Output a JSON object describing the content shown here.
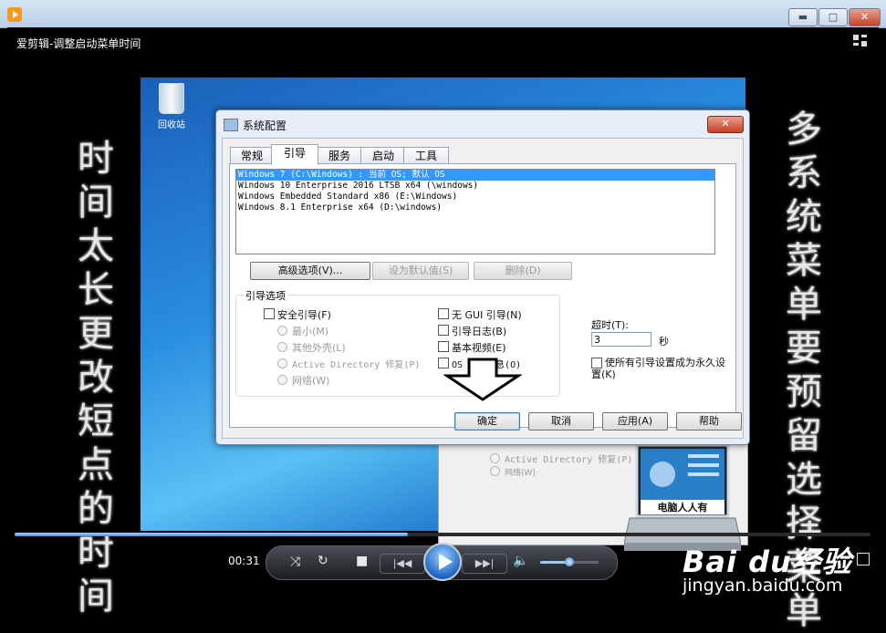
{
  "window": {
    "minimize": "▬",
    "maximize": "□",
    "close": "✕"
  },
  "player": {
    "title": "爱剪辑-调整启动菜单时间",
    "elapsed": "00:31",
    "progress": 0.46,
    "volume": 0.5
  },
  "video": {
    "recycle_bin": "回收站",
    "left_caption": "时间太长更改短点的时间",
    "right_caption": "多系统菜单要预留选择菜单",
    "watermark_brand": "Bai du经验",
    "watermark_url": "jingyan.baidu.com",
    "laptop_caption": "电脑人人有"
  },
  "dialog": {
    "title": "系统配置",
    "close": "✕",
    "tabs": [
      "常规",
      "引导",
      "服务",
      "启动",
      "工具"
    ],
    "active_tab": "引导",
    "os_list": [
      "Windows 7 (C:\\Windows) : 当前 OS; 默认 OS",
      "Windows 10 Enterprise 2016 LTSB x64 (\\windows)",
      "Windows Embedded Standard x86 (E:\\Windows)",
      "Windows 8.1 Enterprise x64 (D:\\windows)"
    ],
    "advanced_button": "高级选项(V)...",
    "set_default_button": "设为默认值(S)",
    "delete_button": "删除(D)",
    "boot_options_label": "引导选项",
    "safe_boot": "安全引导(F)",
    "minimal": "最小(M)",
    "alternate_shell": "其他外壳(L)",
    "ad_repair": "Active Directory 修复(P)",
    "network": "网络(W)",
    "no_gui": "无 GUI 引导(N)",
    "boot_log": "引导日志(B)",
    "base_video": "基本视频(E)",
    "os_boot_info": "OS 引导信息(O)",
    "timeout_label": "超时(T):",
    "timeout_value": "3",
    "seconds": "秒",
    "permanent": "使所有引导设置成为永久设置(K)",
    "ok": "确定",
    "cancel": "取消",
    "apply": "应用(A)",
    "help": "帮助"
  },
  "dialog2": {
    "ad_repair": "Active Directory 修复(P)",
    "network": "网络(W)"
  }
}
